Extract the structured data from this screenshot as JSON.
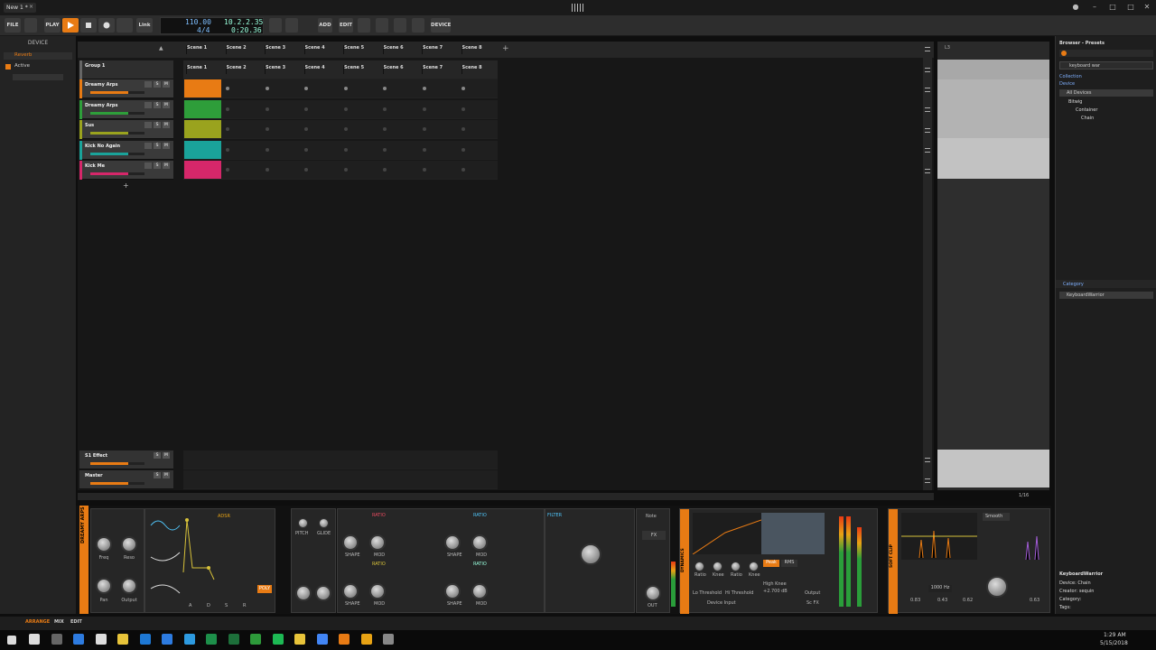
{
  "window": {
    "doc_tab": "New 1 *",
    "close": "×",
    "minimize": "–",
    "maximize": "□",
    "win_close": "✕",
    "dot": "●"
  },
  "toolbar": {
    "file": "FILE",
    "play_label": "PLAY",
    "link": "Link",
    "add": "ADD",
    "edit": "EDIT",
    "device": "DEVICE",
    "tempo": "110.00",
    "signature": "4/4",
    "position": "10.2.2.35",
    "time": "0:20.36"
  },
  "left_panel": {
    "title": "DEVICE",
    "reverb": "Reverb",
    "active": "Active"
  },
  "scenes": [
    "Scene 1",
    "Scene 2",
    "Scene 3",
    "Scene 4",
    "Scene 5",
    "Scene 6",
    "Scene 7",
    "Scene 8"
  ],
  "group": {
    "name": "Group 1"
  },
  "tracks": [
    {
      "name": "Dreamy Arps",
      "color": "#e87b14"
    },
    {
      "name": "Dreamy Arps",
      "color": "#2e9e3a"
    },
    {
      "name": "Sus",
      "color": "#9aa31e"
    },
    {
      "name": "Kick No Again",
      "color": "#1aa39a"
    },
    {
      "name": "Kick Me",
      "color": "#d6276a"
    }
  ],
  "returns": [
    {
      "name": "S1 Effect"
    },
    {
      "name": "Master"
    }
  ],
  "track_buttons": {
    "s": "S",
    "m": "M"
  },
  "arranger": {
    "marker": "L3",
    "zoom": "1/16"
  },
  "browser": {
    "title": "Browser - Presets",
    "search": "keyboard war",
    "collection": "Collection",
    "device": "Device",
    "all_devices": "All Devices",
    "bitwig": "Bitwig",
    "container": "Container",
    "chain": "Chain",
    "category": "Category",
    "result": "KeyboardWarrior",
    "info_name": "KeyboardWarrior",
    "info_device": "Device: Chain",
    "info_creator": "Creator: sequin",
    "info_category": "Category:",
    "info_tags": "Tags:"
  },
  "devices": {
    "synth_name": "DREAMY ARPS",
    "freq": "Freq",
    "reso": "Reso",
    "pan": "Pan",
    "output": "Output",
    "adsr": "ADSR",
    "a": "A",
    "d": "D",
    "s": "S",
    "r": "R",
    "poly": "POLY",
    "pitch": "PITCH",
    "glide": "GLIDE",
    "shape": "SHAPE",
    "mod": "MOD",
    "ratio": "RATIO",
    "filter": "FILTER",
    "note": "Note",
    "fx": "FX",
    "out": "OUT",
    "dynamics": "DYNAMICS",
    "lo_ratio": "Ratio",
    "knee": "Knee",
    "lo_threshold": "Lo Threshold",
    "hi_threshold": "Hi Threshold",
    "peak": "Peak",
    "rms": "RMS",
    "high_knee": "High Knee",
    "high_knee_val": "+2.700 dB",
    "output2": "Output",
    "sc_fx": "Sc FX",
    "device_input": "Device Input",
    "softclip": "SOFT CLIP",
    "smooth": "Smooth",
    "freq_readout": "1000 Hz",
    "val1": "0.83",
    "val2": "0.43",
    "val3": "0.62",
    "val4": "0.63"
  },
  "statusbar": {
    "arrange": "ARRANGE",
    "mix": "MIX",
    "edit": "EDIT"
  },
  "taskbar": {
    "time": "1:29 AM",
    "date": "5/15/2018"
  }
}
